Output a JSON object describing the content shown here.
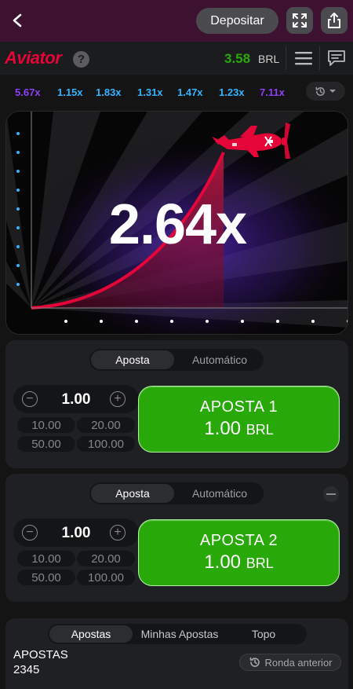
{
  "topbar": {
    "deposit_label": "Depositar"
  },
  "game_header": {
    "logo": "Aviator",
    "help": "?",
    "balance": "3.58",
    "currency": "BRL"
  },
  "history": {
    "multipliers": [
      {
        "value": "5.67x",
        "color": "#913ef8"
      },
      {
        "value": "1.15x",
        "color": "#34b4ff"
      },
      {
        "value": "1.83x",
        "color": "#34b4ff"
      },
      {
        "value": "1.31x",
        "color": "#34b4ff"
      },
      {
        "value": "1.47x",
        "color": "#34b4ff"
      },
      {
        "value": "1.23x",
        "color": "#34b4ff"
      },
      {
        "value": "7.11x",
        "color": "#913ef8"
      }
    ]
  },
  "game": {
    "multiplier": "2.64x"
  },
  "panels": [
    {
      "tab_bet": "Aposta",
      "tab_auto": "Automático",
      "amount": "1.00",
      "quick": [
        "10.00",
        "20.00",
        "50.00",
        "100.00"
      ],
      "button_title": "APOSTA 1",
      "button_amount": "1.00",
      "button_currency": "BRL"
    },
    {
      "tab_bet": "Aposta",
      "tab_auto": "Automático",
      "amount": "1.00",
      "quick": [
        "10.00",
        "20.00",
        "50.00",
        "100.00"
      ],
      "button_title": "APOSTA 2",
      "button_amount": "1.00",
      "button_currency": "BRL"
    }
  ],
  "bets_list": {
    "tabs": [
      "Apostas",
      "Minhas Apostas",
      "Topo"
    ],
    "title": "APOSTAS",
    "count": "2345",
    "previous_round": "Ronda anterior"
  },
  "colors": {
    "topbar": "#3c1230",
    "accent_red": "#e50539",
    "bet_green": "#28a909",
    "balance_green": "#28a909"
  }
}
